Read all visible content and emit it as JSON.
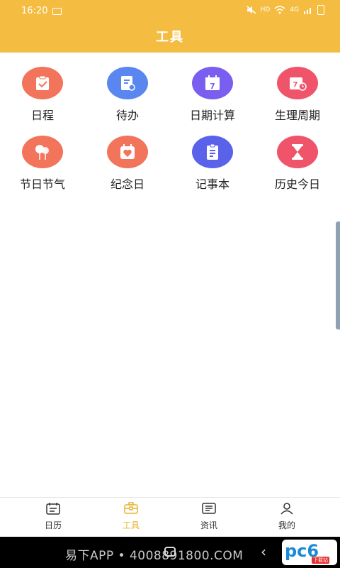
{
  "status": {
    "time": "16:20",
    "hd": "HD",
    "net": "4G"
  },
  "header": {
    "title": "工具"
  },
  "tools": [
    {
      "label": "日程",
      "icon": "clipboard-check-icon",
      "color": "#f2745a"
    },
    {
      "label": "待办",
      "icon": "todo-note-icon",
      "color": "#5a86f0"
    },
    {
      "label": "日期计算",
      "icon": "calendar-7-icon",
      "color": "#7a5ef0"
    },
    {
      "label": "生理周期",
      "icon": "calendar-clock-icon",
      "color": "#f0546a"
    },
    {
      "label": "节日节气",
      "icon": "balloon-icon",
      "color": "#f2745a"
    },
    {
      "label": "纪念日",
      "icon": "heart-calendar-icon",
      "color": "#f2745a"
    },
    {
      "label": "记事本",
      "icon": "notepad-icon",
      "color": "#5a62ea"
    },
    {
      "label": "历史今日",
      "icon": "hourglass-icon",
      "color": "#f0546a"
    }
  ],
  "tabbar": [
    {
      "label": "日历",
      "icon": "calendar-tab-icon"
    },
    {
      "label": "工具",
      "icon": "toolbox-tab-icon",
      "active": true
    },
    {
      "label": "资讯",
      "icon": "news-tab-icon"
    },
    {
      "label": "我的",
      "icon": "profile-tab-icon"
    }
  ],
  "navbar": {
    "watermark": "易下APP • 4008891800.COM"
  },
  "logo": {
    "text": "pc6",
    "tag": "下载站"
  }
}
